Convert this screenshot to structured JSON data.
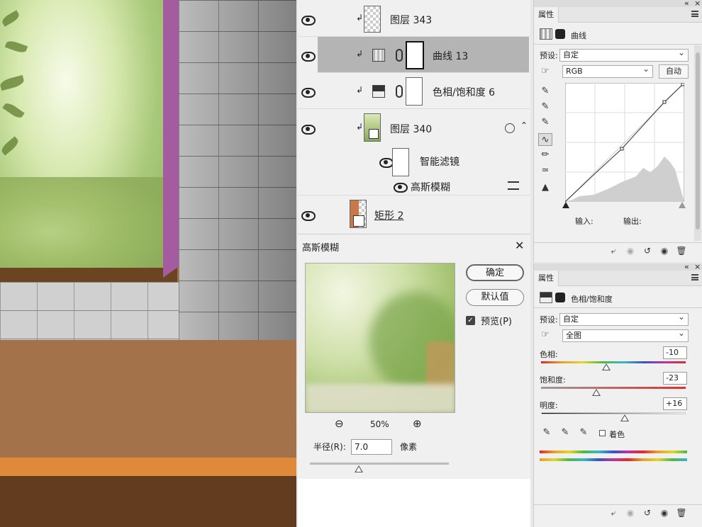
{
  "layers": {
    "rows": [
      {
        "name": "图层 343"
      },
      {
        "name": "曲线 13"
      },
      {
        "name": "色相/饱和度 6"
      },
      {
        "name": "图层 340"
      },
      {
        "name": "智能滤镜"
      },
      {
        "name": "高斯模糊"
      },
      {
        "name": "矩形 2"
      }
    ]
  },
  "gaussian_dialog": {
    "title": "高斯模糊",
    "ok_label": "确定",
    "default_label": "默认值",
    "preview_label": "预览(P)",
    "zoom_level": "50%",
    "radius_label": "半径(R):",
    "radius_value": "7.0",
    "unit_label": "像素",
    "radius_slider_fraction": 0.35
  },
  "curves_panel": {
    "tab_label": "属性",
    "panel_title": "曲线",
    "preset_label": "预设:",
    "preset_value": "自定",
    "channel_value": "RGB",
    "auto_label": "自动",
    "input_label": "输入:",
    "output_label": "输出:"
  },
  "hue_panel": {
    "tab_label": "属性",
    "panel_title": "色相/饱和度",
    "preset_label": "预设:",
    "preset_value": "自定",
    "range_value": "全图",
    "hue_label": "色相:",
    "hue_value": "-10",
    "saturation_label": "饱和度:",
    "saturation_value": "-23",
    "lightness_label": "明度:",
    "lightness_value": "+16",
    "colorize_label": "着色"
  },
  "colors": {
    "selected_row": "#b4b4b4",
    "frame_purple": "#a45ba0",
    "stripe_orange": "#df8a3a",
    "floor_brown": "#a3714a"
  },
  "icons": [
    "eye-icon",
    "clip-arrow-icon",
    "link-icon",
    "curves-icon",
    "hue-icon",
    "close-icon",
    "zoom-out-icon",
    "zoom-in-icon",
    "eyedropper-icon",
    "pencil-icon",
    "hand-icon",
    "trash-icon",
    "reset-icon"
  ]
}
